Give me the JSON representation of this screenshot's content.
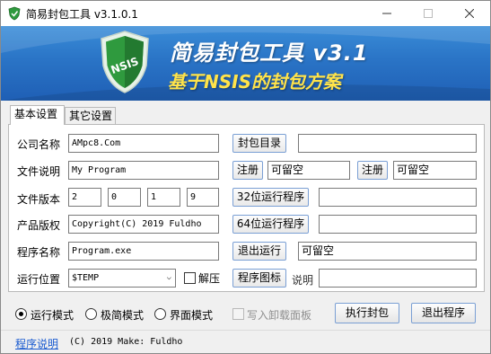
{
  "window": {
    "title": "简易封包工具 v3.1.0.1"
  },
  "banner": {
    "title": "简易封包工具 v3.1",
    "subtitle": "基于NSIS的封包方案",
    "shield_text": "NSIS"
  },
  "tabs": [
    {
      "label": "基本设置",
      "active": true
    },
    {
      "label": "其它设置",
      "active": false
    }
  ],
  "form": {
    "company": {
      "label": "公司名称",
      "value": "AMpc8.Com",
      "button": "封包目录",
      "extra_value": ""
    },
    "description": {
      "label": "文件说明",
      "value": "My Program",
      "button1": "注册",
      "value1": "可留空",
      "button2": "注册",
      "value2": "可留空"
    },
    "version": {
      "label": "文件版本",
      "parts": [
        "2",
        "0",
        "1",
        "9"
      ],
      "button": "32位运行程序",
      "extra_value": ""
    },
    "copyright": {
      "label": "产品版权",
      "value": "Copyright(C) 2019 Fuldho",
      "button": "64位运行程序",
      "extra_value": ""
    },
    "program": {
      "label": "程序名称",
      "value": "Program.exe",
      "button": "退出运行",
      "extra_value": "可留空"
    },
    "location": {
      "label": "运行位置",
      "value": "$TEMP",
      "unzip_label": "解压",
      "unzip_checked": false,
      "button": "程序图标",
      "desc_label": "说明",
      "desc_value": ""
    }
  },
  "modes": [
    {
      "label": "运行模式",
      "selected": true
    },
    {
      "label": "极简模式",
      "selected": false
    },
    {
      "label": "界面模式",
      "selected": false
    }
  ],
  "uninstall_option": {
    "label": "写入卸载面板",
    "checked": false,
    "enabled": false
  },
  "actions": {
    "execute": "执行封包",
    "exit": "退出程序"
  },
  "statusbar": {
    "help_link": "程序说明",
    "copyright": "(C) 2019 Make: Fuldho"
  },
  "colors": {
    "banner_top": "#3a8dd8",
    "banner_bottom": "#1f5fb5",
    "subtitle": "#ffe34a",
    "shield_green": "#2f9a3e",
    "link": "#1a5bd0"
  }
}
